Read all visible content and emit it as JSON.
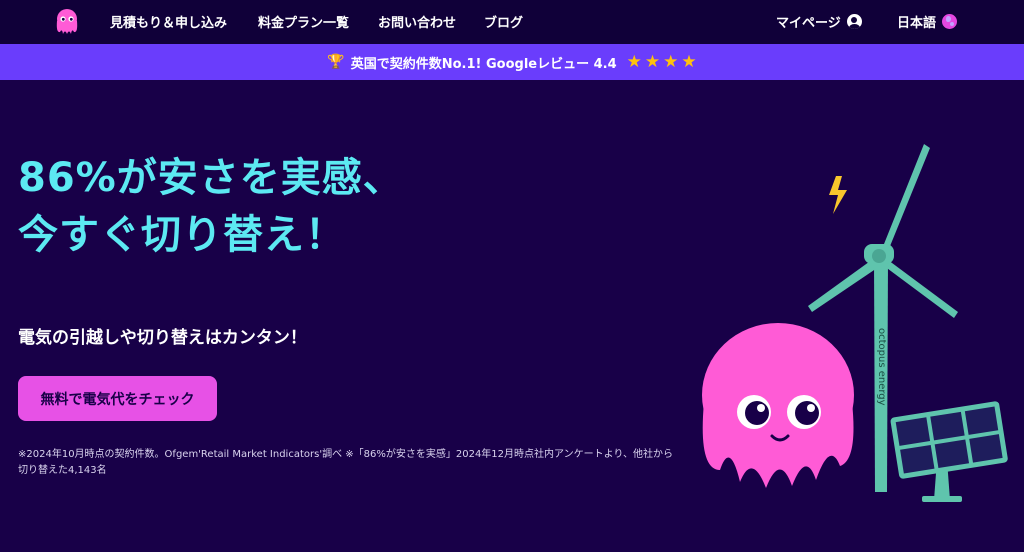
{
  "nav": {
    "links": [
      "見積もり＆申し込み",
      "料金プラン一覧",
      "お問い合わせ",
      "ブログ"
    ],
    "mypage": "マイページ",
    "language": "日本語",
    "icons": {
      "logo": "octopus-logo-icon",
      "account": "user-icon",
      "language": "globe-icon"
    }
  },
  "promo": {
    "text": "英国で契約件数No.1! Googleレビュー 4.4",
    "rating": 4.4,
    "stars_shown": 4,
    "icon": "trophy-icon"
  },
  "hero": {
    "headline_line1": "86%が安さを実感、",
    "headline_line2": "今すぐ切り替え！",
    "subheadline": "電気の引越しや切り替えはカンタン！",
    "cta_label": "無料で電気代をチェック",
    "footnote": "※2024年10月時点の契約件数。Ofgem'Retail Market Indicators'調べ ※「86%が安さを実感」2024年12月時点社内アンケートより、他社から切り替えた4,143名",
    "turbine_brand": "octopus energy"
  },
  "colors": {
    "background": "#180048",
    "nav_background": "#100039",
    "promo_bar": "#6a3dfc",
    "headline": "#5ce9f2",
    "cta": "#e751e6",
    "octopus": "#ff5bd6",
    "turbine": "#5fc4ad"
  }
}
